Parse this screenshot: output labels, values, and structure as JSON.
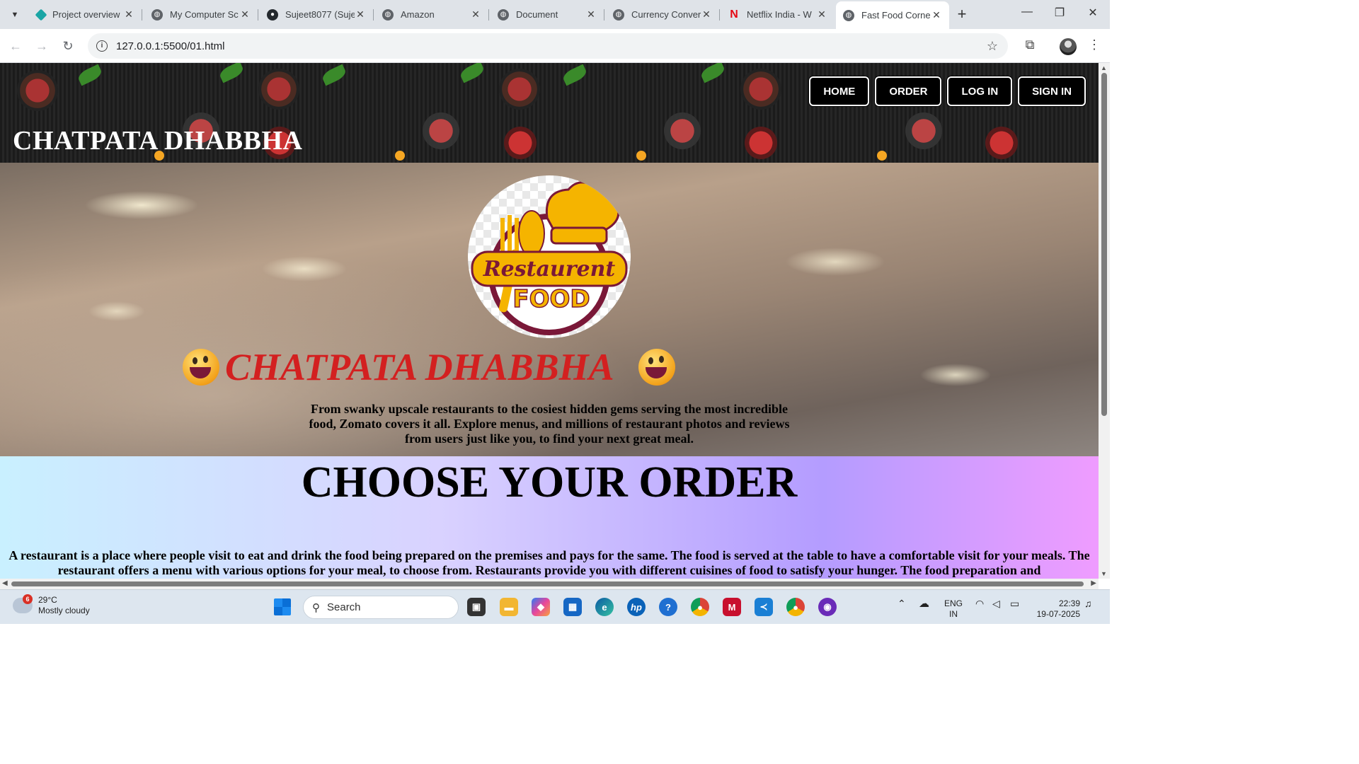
{
  "browser": {
    "tabs": [
      {
        "label": "Project overview",
        "favicon": "diamond-icon",
        "color": "#1aa5a5"
      },
      {
        "label": "My Computer Sc",
        "favicon": "globe-icon",
        "color": "#5f6368"
      },
      {
        "label": "Sujeet8077 (Suje",
        "favicon": "github-icon",
        "color": "#24292e"
      },
      {
        "label": "Amazon",
        "favicon": "globe-icon",
        "color": "#5f6368"
      },
      {
        "label": "Document",
        "favicon": "globe-icon",
        "color": "#5f6368"
      },
      {
        "label": "Currency Conver",
        "favicon": "globe-icon",
        "color": "#5f6368"
      },
      {
        "label": "Netflix India - W",
        "favicon": "netflix-icon",
        "color": "#e50914"
      },
      {
        "label": "Fast Food Corne",
        "favicon": "globe-icon",
        "color": "#5f6368"
      }
    ],
    "new_tab": "+",
    "url": "127.0.0.1:5500/01.html"
  },
  "page": {
    "site_title": "CHATPATA DHABBHA",
    "nav": [
      "HOME",
      "ORDER",
      "LOG IN",
      "SIGN IN"
    ],
    "logo": {
      "word1": "Restaurent",
      "word2": "FOOD"
    },
    "hero_title": "CHATPATA DHABBHA",
    "hero_desc": "From swanky upscale restaurants to the cosiest hidden gems serving the most incredible food, Zomato covers it all. Explore menus, and millions of restaurant photos and reviews from users just like you, to find your next great meal.",
    "order_title": "CHOOSE YOUR ORDER",
    "order_text": "A restaurant is a place where people visit to eat and drink the food being prepared on the premises and pays for the same. The food is served at the table to have a comfortable visit for your meals. The restaurant offers a menu with various options for your meal, to choose from. Restaurants provide you with different cuisines of food to satisfy your hunger. The food preparation and",
    "colors": {
      "hero_title": "#d32020",
      "logo_yellow": "#f5b400",
      "logo_maroon": "#7a1838"
    }
  },
  "taskbar": {
    "weather_badge": "6",
    "temperature": "29°C",
    "condition": "Mostly cloudy",
    "search_label": "Search",
    "lang": "ENG",
    "region": "IN",
    "time": "22:39",
    "date": "19-07-2025"
  }
}
